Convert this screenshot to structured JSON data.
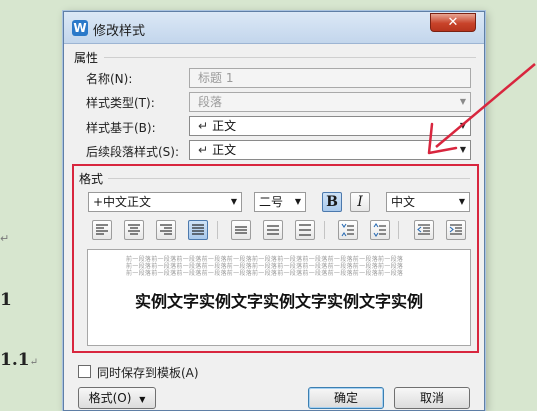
{
  "background": {
    "marks": [
      "↵"
    ],
    "headings": [
      {
        "text": "1",
        "ret": ""
      },
      {
        "text": "1.1",
        "ret": "↵"
      }
    ]
  },
  "dialog": {
    "title": "修改样式",
    "app_icon": "W",
    "close_label": "✕",
    "properties": {
      "group_label": "属性",
      "name_label": "名称(N):",
      "name_value": "标题 1",
      "type_label": "样式类型(T):",
      "type_value": "段落",
      "based_on_label": "样式基于(B):",
      "based_on_value": "正文",
      "next_label": "后续段落样式(S):",
      "next_value": "正文"
    },
    "format": {
      "group_label": "格式",
      "font": "+中文正文",
      "size": "二号",
      "bold_label": "B",
      "italic_label": "I",
      "language": "中文",
      "bold_active": true,
      "alignment_active": "justify",
      "preview_lines": [
        "前一段落前一段落前一段落前一段落前一段落前一段落前一段落前一段落前一段落前一段落前一段落",
        "前一段落前一段落前一段落前一段落前一段落前一段落前一段落前一段落前一段落前一段落前一段落",
        "前一段落前一段落前一段落前一段落前一段落前一段落前一段落前一段落前一段落前一段落前一段落"
      ],
      "sample_text": "实例文字实例文字实例文字实例文字实例"
    },
    "save_to_template_label": "同时保存到模板(A)",
    "format_menu_label": "格式(O)",
    "ok_label": "确定",
    "cancel_label": "取消"
  },
  "colors": {
    "highlight_box": "#d8263e",
    "annotation_arrow": "#d8263e",
    "close_button": "#c8432a"
  }
}
